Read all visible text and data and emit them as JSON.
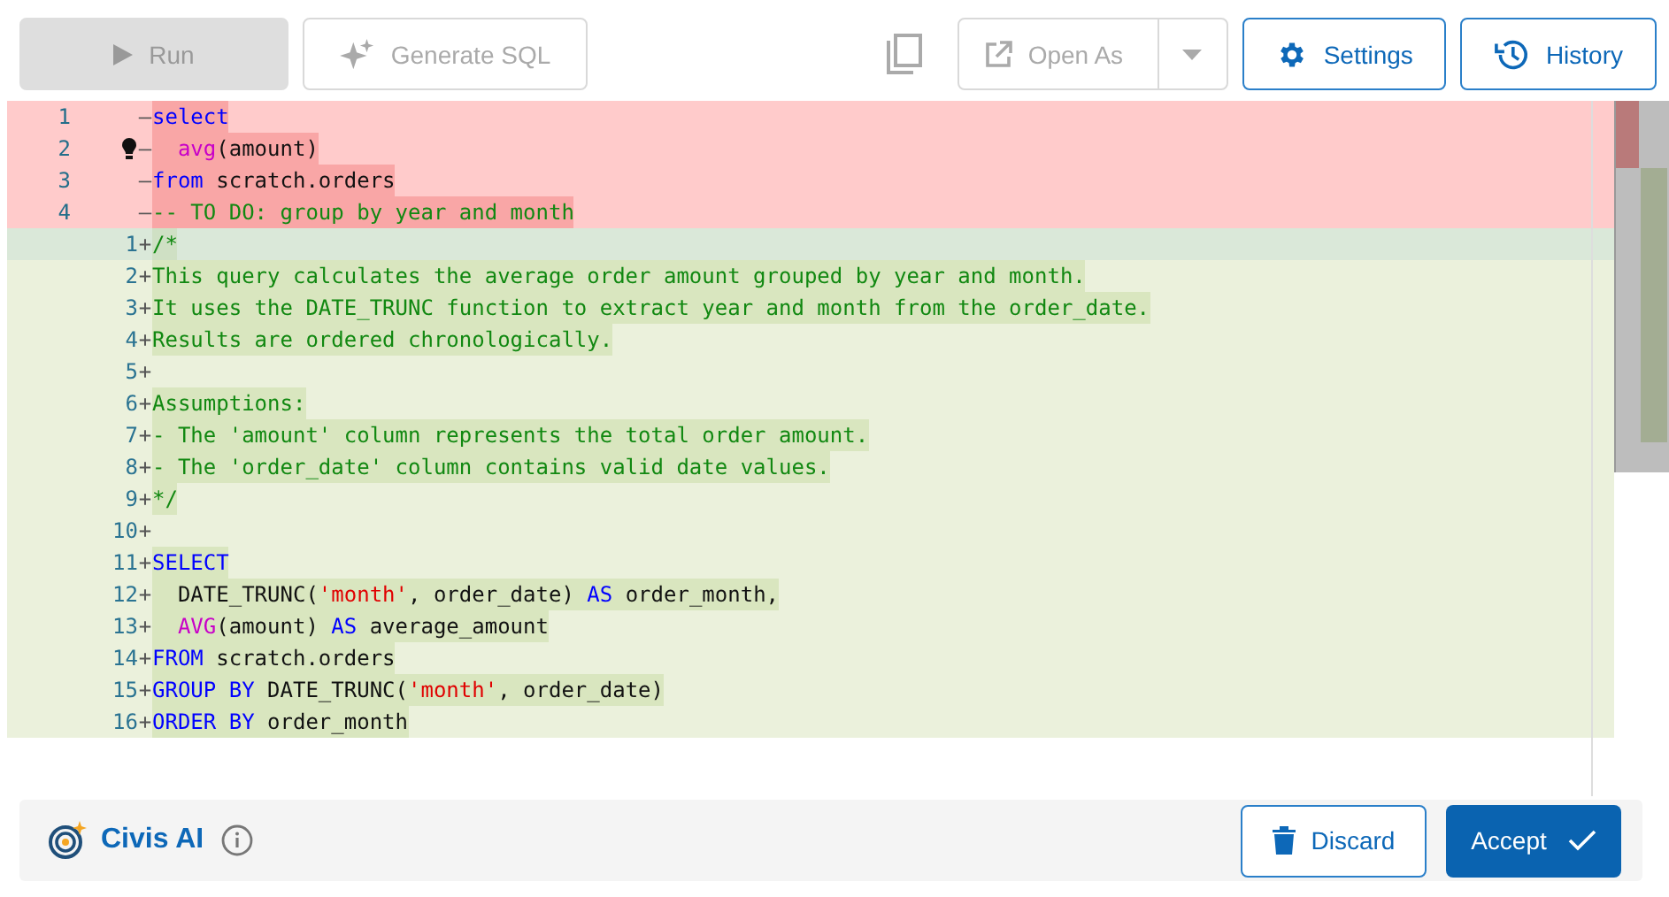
{
  "toolbar": {
    "run": {
      "label": "Run",
      "disabled": true
    },
    "generate_sql": {
      "label": "Generate SQL",
      "disabled": true
    },
    "copy": {
      "disabled": true
    },
    "open_as": {
      "label": "Open As",
      "disabled": true
    },
    "settings": {
      "label": "Settings"
    },
    "history": {
      "label": "History"
    }
  },
  "diff": {
    "removed_lines": [
      {
        "number": "1",
        "marker": "—",
        "lightbulb": false,
        "tokens": [
          {
            "kind": "keyword",
            "text": "select"
          }
        ]
      },
      {
        "number": "2",
        "marker": "—",
        "lightbulb": true,
        "tokens": [
          {
            "kind": "function",
            "text": "  avg"
          },
          {
            "kind": "plain",
            "text": "(amount)"
          }
        ]
      },
      {
        "number": "3",
        "marker": "—",
        "lightbulb": false,
        "tokens": [
          {
            "kind": "keyword",
            "text": "from"
          },
          {
            "kind": "plain",
            "text": " scratch.orders"
          }
        ]
      },
      {
        "number": "4",
        "marker": "—",
        "lightbulb": false,
        "tokens": [
          {
            "kind": "comment",
            "text": "-- TO DO: group by year and month"
          }
        ]
      }
    ],
    "added_lines": [
      {
        "number": "1",
        "marker": "+",
        "current": true,
        "tokens": [
          {
            "kind": "comment",
            "text": "/*"
          }
        ]
      },
      {
        "number": "2",
        "marker": "+",
        "current": false,
        "tokens": [
          {
            "kind": "comment",
            "text": "This query calculates the average order amount grouped by year and month."
          }
        ]
      },
      {
        "number": "3",
        "marker": "+",
        "current": false,
        "tokens": [
          {
            "kind": "comment",
            "text": "It uses the DATE_TRUNC function to extract year and month from the order_date."
          }
        ]
      },
      {
        "number": "4",
        "marker": "+",
        "current": false,
        "tokens": [
          {
            "kind": "comment",
            "text": "Results are ordered chronologically."
          }
        ]
      },
      {
        "number": "5",
        "marker": "+",
        "current": false
      },
      {
        "number": "6",
        "marker": "+",
        "current": false,
        "tokens": [
          {
            "kind": "comment",
            "text": "Assumptions:"
          }
        ]
      },
      {
        "number": "7",
        "marker": "+",
        "current": false,
        "tokens": [
          {
            "kind": "comment",
            "text": "- The 'amount' column represents the total order amount."
          }
        ]
      },
      {
        "number": "8",
        "marker": "+",
        "current": false,
        "tokens": [
          {
            "kind": "comment",
            "text": "- The 'order_date' column contains valid date values."
          }
        ]
      },
      {
        "number": "9",
        "marker": "+",
        "current": false,
        "tokens": [
          {
            "kind": "comment",
            "text": "*/"
          }
        ]
      },
      {
        "number": "10",
        "marker": "+",
        "current": false
      },
      {
        "number": "11",
        "marker": "+",
        "current": false,
        "tokens": [
          {
            "kind": "keyword",
            "text": "SELECT"
          }
        ]
      },
      {
        "number": "12",
        "marker": "+",
        "current": false,
        "tokens": [
          {
            "kind": "plain",
            "text": "  DATE_TRUNC("
          },
          {
            "kind": "string",
            "text": "'month'"
          },
          {
            "kind": "plain",
            "text": ", order_date) "
          },
          {
            "kind": "keyword",
            "text": "AS"
          },
          {
            "kind": "plain",
            "text": " order_month,"
          }
        ]
      },
      {
        "number": "13",
        "marker": "+",
        "current": false,
        "tokens": [
          {
            "kind": "function",
            "text": "  AVG"
          },
          {
            "kind": "plain",
            "text": "(amount) "
          },
          {
            "kind": "keyword",
            "text": "AS"
          },
          {
            "kind": "plain",
            "text": " average_amount"
          }
        ]
      },
      {
        "number": "14",
        "marker": "+",
        "current": false,
        "tokens": [
          {
            "kind": "keyword",
            "text": "FROM"
          },
          {
            "kind": "plain",
            "text": " scratch.orders"
          }
        ]
      },
      {
        "number": "15",
        "marker": "+",
        "current": false,
        "tokens": [
          {
            "kind": "keyword",
            "text": "GROUP BY"
          },
          {
            "kind": "plain",
            "text": " DATE_TRUNC("
          },
          {
            "kind": "string",
            "text": "'month'"
          },
          {
            "kind": "plain",
            "text": ", order_date)"
          }
        ]
      },
      {
        "number": "16",
        "marker": "+",
        "current": false,
        "tokens": [
          {
            "kind": "keyword",
            "text": "ORDER BY"
          },
          {
            "kind": "plain",
            "text": " order_month"
          }
        ]
      }
    ]
  },
  "footer": {
    "title": "Civis AI",
    "discard": {
      "label": "Discard"
    },
    "accept": {
      "label": "Accept"
    }
  }
}
